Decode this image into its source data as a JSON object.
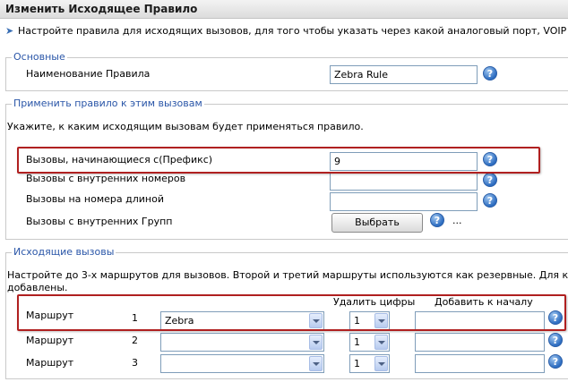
{
  "window": {
    "title": "Изменить Исходящее Правило"
  },
  "hint": {
    "text": "Настройте правила для исходящих вызовов, для того чтобы указать через какой аналоговый порт, VOIP оператора и"
  },
  "basic": {
    "legend": "Основные",
    "rule_name_label": "Наименование Правила",
    "rule_name_value": "Zebra Rule"
  },
  "apply": {
    "legend": "Применить правило к этим вызовам",
    "description": "Укажите, к каким исходящим вызовам будет применяться правило.",
    "prefix_label": "Вызовы, начинающиеся с(Префикс)",
    "prefix_value": "9",
    "internal_numbers_label": "Вызовы с внутренних номеров",
    "internal_numbers_value": "",
    "length_label": "Вызовы на номера длиной",
    "length_value": "",
    "groups_label": "Вызовы с внутренних Групп",
    "select_button": "Выбрать",
    "more": "..."
  },
  "outgoing": {
    "legend": "Исходящие вызовы",
    "description_line1": "Настройте до 3-х маршрутов для вызовов. Второй и третий маршруты используются как резервные. Для каждого маршр",
    "description_line2": "добавлены.",
    "col_strip": "Удалить цифры",
    "col_prepend": "Добавить к началу",
    "routes": [
      {
        "label": "Маршрут",
        "number": "1",
        "trunk": "Zebra",
        "strip": "1",
        "prepend": ""
      },
      {
        "label": "Маршрут",
        "number": "2",
        "trunk": "",
        "strip": "1",
        "prepend": ""
      },
      {
        "label": "Маршрут",
        "number": "3",
        "trunk": "",
        "strip": "1",
        "prepend": ""
      }
    ]
  },
  "icons": {
    "help": "help-icon",
    "hint": "arrow-icon"
  },
  "colors": {
    "legend": "#2a56a8",
    "highlight": "#b02020",
    "help": "#2d6dc1"
  },
  "help_glyph": "?"
}
